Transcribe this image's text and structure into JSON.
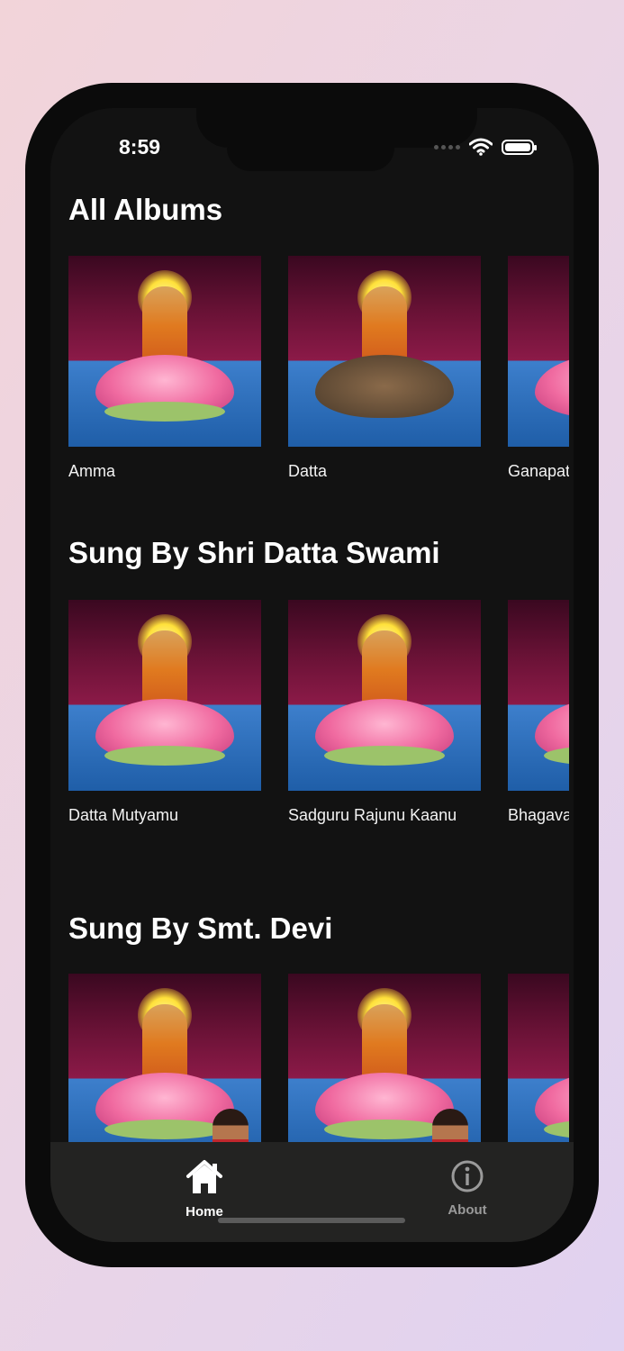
{
  "status_bar": {
    "time": "8:59"
  },
  "sections": [
    {
      "title": "All Albums",
      "albums": [
        {
          "label": "Amma"
        },
        {
          "label": "Datta"
        },
        {
          "label": "Ganapati"
        }
      ]
    },
    {
      "title": "Sung By Shri Datta Swami",
      "albums": [
        {
          "label": "Datta Mutyamu"
        },
        {
          "label": "Sadguru Rajunu Kaanu"
        },
        {
          "label": "Bhagavad"
        }
      ]
    },
    {
      "title": "Sung By Smt. Devi",
      "albums": [
        {
          "label": ""
        },
        {
          "label": ""
        },
        {
          "label": ""
        }
      ]
    }
  ],
  "tabbar": {
    "home_label": "Home",
    "about_label": "About",
    "active": "Home",
    "active_color": "#ffffff",
    "inactive_color": "#9a9a9a"
  },
  "icons": {
    "home": "home-icon",
    "about": "info-icon",
    "wifi": "wifi-icon",
    "battery": "battery-icon"
  }
}
